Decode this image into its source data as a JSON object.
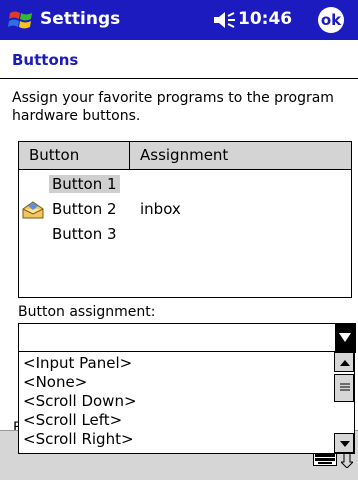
{
  "titlebar": {
    "app_title": "Settings",
    "time": "10:46",
    "ok_label": "ok",
    "icons": [
      "windows-start-icon",
      "volume-icon"
    ],
    "colors": {
      "titlebar_bg": "#1b1bbf",
      "text": "#ffffff"
    }
  },
  "page": {
    "heading": "Buttons",
    "instructions": "Assign your favorite programs to the program hardware buttons."
  },
  "table": {
    "columns": [
      "Button",
      "Assignment"
    ],
    "rows": [
      {
        "button": "Button 1",
        "assignment": "",
        "selected": true
      },
      {
        "button": "Button 2",
        "assignment": "inbox",
        "icon": "envelope-icon"
      },
      {
        "button": "Button 3",
        "assignment": ""
      }
    ]
  },
  "assignment": {
    "label": "Button assignment:",
    "current_value": "",
    "options": [
      "<Input Panel>",
      "<None>",
      "<Scroll Down>",
      "<Scroll Left>",
      "<Scroll Right>"
    ]
  },
  "background_fragment": "F",
  "bottom_bar": {
    "icons": [
      "keyboard-icon",
      "sip-arrow-icon"
    ]
  }
}
